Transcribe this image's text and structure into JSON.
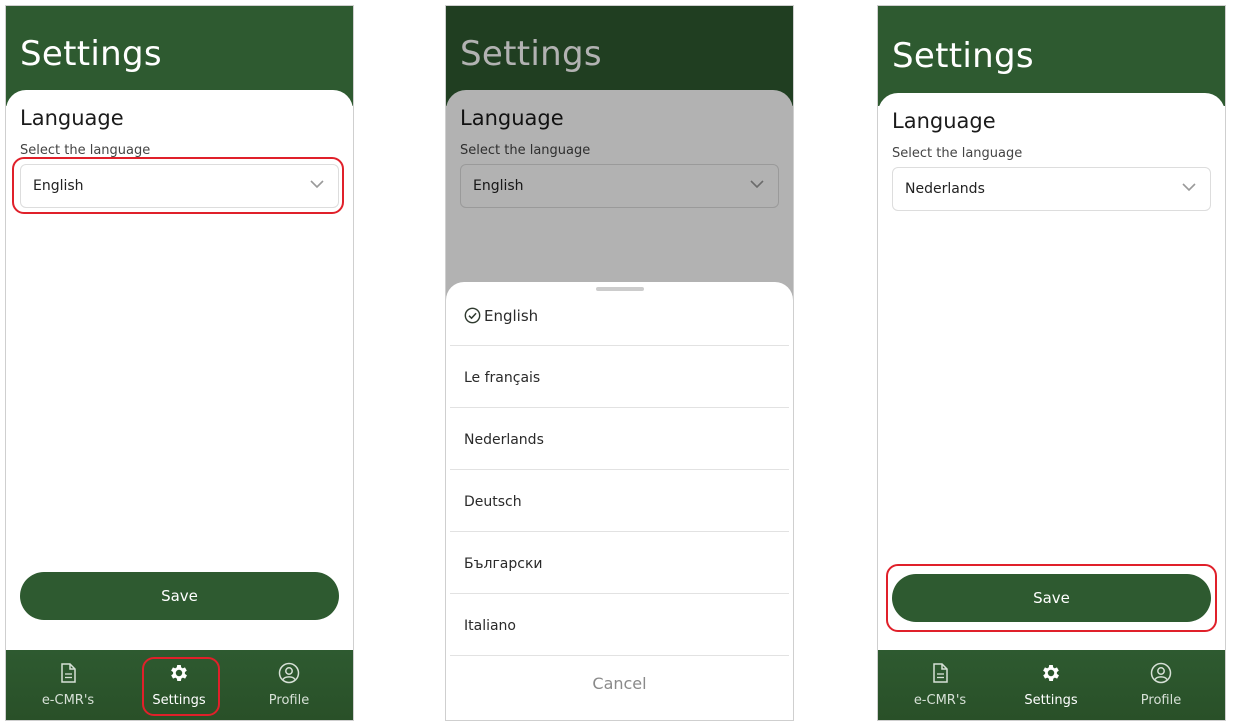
{
  "screens": [
    {
      "header_title": "Settings",
      "section_title": "Language",
      "field_label": "Select the language",
      "selected_language": "English",
      "save_label": "Save",
      "tabs": [
        {
          "label": "e-CMR's",
          "icon": "document-icon"
        },
        {
          "label": "Settings",
          "icon": "gear-icon"
        },
        {
          "label": "Profile",
          "icon": "user-circle-icon"
        }
      ]
    },
    {
      "header_title": "Settings",
      "section_title": "Language",
      "field_label": "Select the language",
      "selected_language": "English",
      "options": [
        "English",
        "Le français",
        "Nederlands",
        "Deutsch",
        "Български",
        "Italiano"
      ],
      "cancel_label": "Cancel"
    },
    {
      "header_title": "Settings",
      "section_title": "Language",
      "field_label": "Select the language",
      "selected_language": "Nederlands",
      "save_label": "Save",
      "tabs": [
        {
          "label": "e-CMR's",
          "icon": "document-icon"
        },
        {
          "label": "Settings",
          "icon": "gear-icon"
        },
        {
          "label": "Profile",
          "icon": "user-circle-icon"
        }
      ]
    }
  ],
  "colors": {
    "brand_green": "#2e5a30",
    "highlight_red": "#e0202a",
    "overlay": "#000000"
  }
}
